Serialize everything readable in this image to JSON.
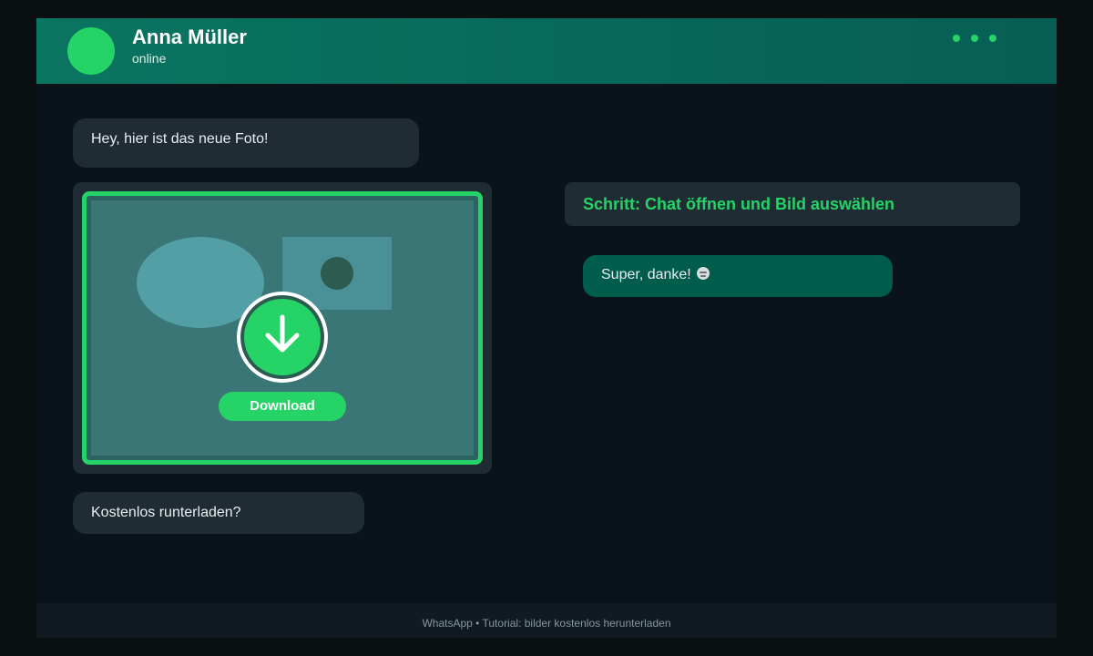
{
  "header": {
    "contact_name": "Anna Müller",
    "status": "online",
    "menu_icon": "more-dots-icon"
  },
  "messages": {
    "incoming_1": "Hey, hier ist das neue Foto!",
    "incoming_2": "Kostenlos runterladen?",
    "outgoing_1": "Super, danke!",
    "outgoing_1_emoji_icon": "expressionless-face-icon"
  },
  "image_message": {
    "download_icon": "download-arrow-icon",
    "download_label": "Download"
  },
  "step_banner": {
    "text": "Schritt: Chat öffnen und Bild auswählen"
  },
  "footer": {
    "text": "WhatsApp • Tutorial: bilder kostenlos herunterladen"
  },
  "colors": {
    "accent": "#25d366",
    "header": "#075e54",
    "incoming_bubble": "#1f2c34",
    "outgoing_bubble": "#005c4b",
    "background": "#0b131a"
  }
}
